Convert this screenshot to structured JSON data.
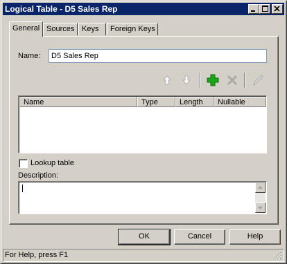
{
  "window": {
    "title": "Logical Table - D5 Sales Rep",
    "controls": [
      "minimize-icon",
      "maximize-icon",
      "close-icon"
    ]
  },
  "tabs": [
    {
      "label": "General",
      "active": true
    },
    {
      "label": "Sources",
      "active": false
    },
    {
      "label": "Keys",
      "active": false
    },
    {
      "label": "Foreign Keys",
      "active": false
    }
  ],
  "general": {
    "name_label": "Name:",
    "name_value": "D5 Sales Rep",
    "toolbar": [
      "arrow-up-icon",
      "arrow-down-icon",
      "add-icon",
      "delete-icon",
      "edit-icon"
    ],
    "columns_table": {
      "headers": [
        "Name",
        "Type",
        "Length",
        "Nullable"
      ],
      "rows": []
    },
    "lookup_label": "Lookup table",
    "lookup_checked": false,
    "description_label": "Description:",
    "description_value": ""
  },
  "buttons": {
    "ok": "OK",
    "cancel": "Cancel",
    "help": "Help"
  },
  "status": {
    "text": "For Help, press F1"
  },
  "colors": {
    "titlebar": "#0a246a",
    "face": "#d4d0c8",
    "add_icon": "#1aa51a"
  }
}
